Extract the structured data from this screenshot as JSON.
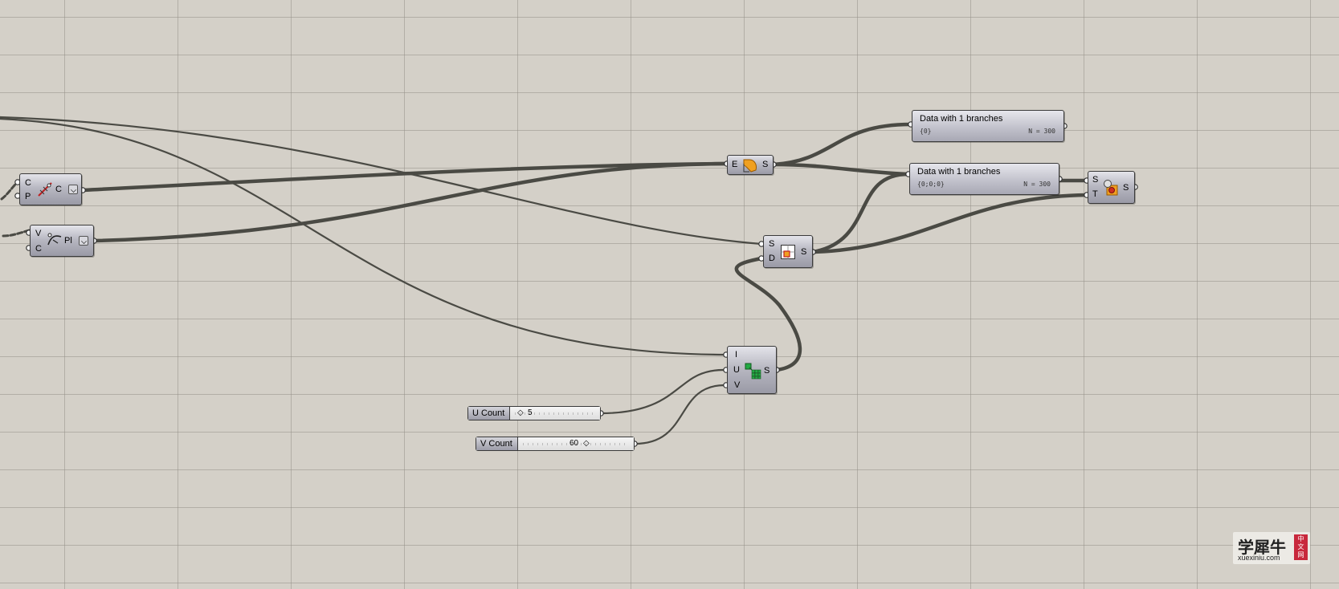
{
  "canvas": {
    "background": "#d4d0c8",
    "wire_color": "#4a4a44"
  },
  "components": {
    "curve_param": {
      "inputs": [
        "C",
        "P"
      ],
      "output": "C",
      "icon": "curve-evaluate-icon"
    },
    "curve_plane": {
      "inputs": [
        "V",
        "C"
      ],
      "output": "Pl",
      "icon": "curve-frame-icon"
    },
    "entwine": {
      "inputs": [
        "E"
      ],
      "output": "S",
      "icon": "entwine-icon"
    },
    "divide_domain": {
      "inputs": [
        "S",
        "D"
      ],
      "output": "S",
      "icon": "divide-domain-icon"
    },
    "surface_isotrim": {
      "inputs": [
        "S",
        "T"
      ],
      "output": "S",
      "icon": "isotrim-icon"
    },
    "divide_surface": {
      "inputs": [
        "I",
        "U",
        "V"
      ],
      "output": "S",
      "icon": "divide-surface-icon"
    }
  },
  "panels": [
    {
      "title": "Data with 1 branches",
      "path": "{0}",
      "count": "N = 300"
    },
    {
      "title": "Data with 1 branches",
      "path": "{0;0;0}",
      "count": "N = 300"
    }
  ],
  "sliders": [
    {
      "name": "U Count",
      "value": "5"
    },
    {
      "name": "V Count",
      "value": "60"
    }
  ],
  "watermark": {
    "chinese": "学犀牛",
    "url": "xuexiniu.com",
    "badge": [
      "中",
      "文",
      "网"
    ]
  }
}
